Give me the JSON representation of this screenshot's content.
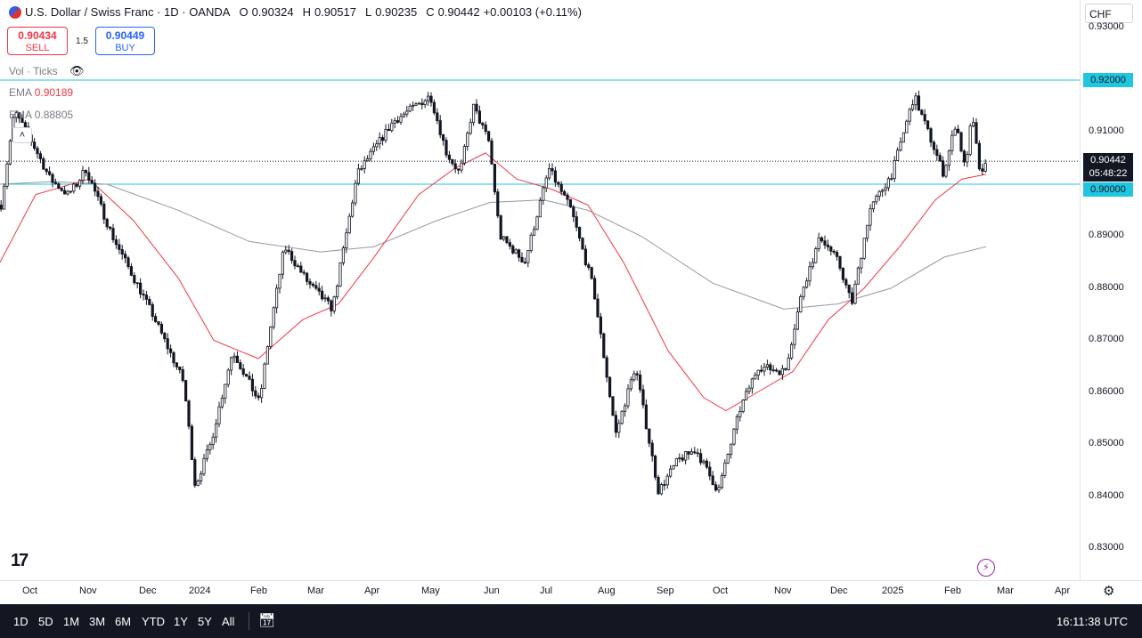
{
  "header": {
    "symbol": "U.S. Dollar / Swiss Franc · 1D · OANDA",
    "open_k": "O",
    "open": "0.90324",
    "high_k": "H",
    "high": "0.90517",
    "low_k": "L",
    "low": "0.90235",
    "close_k": "C",
    "close": "0.90442",
    "change": "+0.00103 (+0.11%)"
  },
  "trade": {
    "sell_price": "0.90434",
    "sell_label": "SELL",
    "spread": "1.5",
    "buy_price": "0.90449",
    "buy_label": "BUY"
  },
  "indicators": {
    "volume_label": "Vol · Ticks",
    "ema_fast_label": "EMA",
    "ema_fast_value": "0.90189",
    "ema_slow_label": "EMA",
    "ema_slow_value": "0.88805",
    "collapse_icon": "chevron-up"
  },
  "price_scale": {
    "currency": "CHF",
    "ticks": [
      "0.93000",
      "0.92000",
      "0.91000",
      "0.90000",
      "0.89000",
      "0.88000",
      "0.87000",
      "0.86000",
      "0.85000",
      "0.84000",
      "0.83000"
    ],
    "label_upper": "0.92000",
    "label_lower": "0.90000",
    "current_price": "0.90442",
    "countdown": "05:48:22"
  },
  "time_axis": [
    "Oct",
    "Nov",
    "Dec",
    "2024",
    "Feb",
    "Mar",
    "Apr",
    "May",
    "Jun",
    "Jul",
    "Aug",
    "Sep",
    "Oct",
    "Nov",
    "Dec",
    "2025",
    "Feb",
    "Mar",
    "Apr"
  ],
  "bottom_bar": {
    "ranges": [
      "1D",
      "5D",
      "1M",
      "3M",
      "6M",
      "YTD",
      "1Y",
      "5Y",
      "All"
    ],
    "clock": "16:11:38 UTC"
  },
  "colors": {
    "candle": "#131722",
    "ema_fast": "#f23645",
    "ema_slow": "#9598a1",
    "hline": "#20c5e0",
    "bar_bg": "#131722"
  },
  "chart_data": {
    "type": "candlestick",
    "ylim": [
      0.825,
      0.935
    ],
    "horizontal_lines": [
      0.92,
      0.9
    ],
    "current_price": 0.90442,
    "price_anchors": [
      {
        "t": 0,
        "p": 0.896
      },
      {
        "t": 15,
        "p": 0.914
      },
      {
        "t": 35,
        "p": 0.908
      },
      {
        "t": 55,
        "p": 0.901
      },
      {
        "t": 75,
        "p": 0.898
      },
      {
        "t": 85,
        "p": 0.9
      },
      {
        "t": 95,
        "p": 0.903
      },
      {
        "t": 125,
        "p": 0.89
      },
      {
        "t": 170,
        "p": 0.875
      },
      {
        "t": 205,
        "p": 0.862
      },
      {
        "t": 218,
        "p": 0.842
      },
      {
        "t": 235,
        "p": 0.85
      },
      {
        "t": 260,
        "p": 0.868
      },
      {
        "t": 290,
        "p": 0.858
      },
      {
        "t": 300,
        "p": 0.87
      },
      {
        "t": 318,
        "p": 0.888
      },
      {
        "t": 345,
        "p": 0.881
      },
      {
        "t": 372,
        "p": 0.876
      },
      {
        "t": 400,
        "p": 0.902
      },
      {
        "t": 440,
        "p": 0.912
      },
      {
        "t": 482,
        "p": 0.917
      },
      {
        "t": 500,
        "p": 0.906
      },
      {
        "t": 515,
        "p": 0.902
      },
      {
        "t": 530,
        "p": 0.915
      },
      {
        "t": 548,
        "p": 0.908
      },
      {
        "t": 560,
        "p": 0.89
      },
      {
        "t": 588,
        "p": 0.885
      },
      {
        "t": 615,
        "p": 0.903
      },
      {
        "t": 640,
        "p": 0.895
      },
      {
        "t": 665,
        "p": 0.88
      },
      {
        "t": 690,
        "p": 0.852
      },
      {
        "t": 712,
        "p": 0.865
      },
      {
        "t": 738,
        "p": 0.841
      },
      {
        "t": 760,
        "p": 0.847
      },
      {
        "t": 780,
        "p": 0.849
      },
      {
        "t": 805,
        "p": 0.841
      },
      {
        "t": 830,
        "p": 0.857
      },
      {
        "t": 850,
        "p": 0.865
      },
      {
        "t": 880,
        "p": 0.864
      },
      {
        "t": 900,
        "p": 0.88
      },
      {
        "t": 920,
        "p": 0.89
      },
      {
        "t": 940,
        "p": 0.885
      },
      {
        "t": 955,
        "p": 0.877
      },
      {
        "t": 975,
        "p": 0.895
      },
      {
        "t": 1000,
        "p": 0.902
      },
      {
        "t": 1025,
        "p": 0.917
      },
      {
        "t": 1045,
        "p": 0.908
      },
      {
        "t": 1058,
        "p": 0.902
      },
      {
        "t": 1072,
        "p": 0.912
      },
      {
        "t": 1082,
        "p": 0.903
      },
      {
        "t": 1090,
        "p": 0.913
      },
      {
        "t": 1100,
        "p": 0.901
      },
      {
        "t": 1107,
        "p": 0.9044
      }
    ],
    "ema_fast": [
      {
        "t": 0,
        "p": 0.885
      },
      {
        "t": 40,
        "p": 0.898
      },
      {
        "t": 100,
        "p": 0.901
      },
      {
        "t": 150,
        "p": 0.893
      },
      {
        "t": 200,
        "p": 0.882
      },
      {
        "t": 240,
        "p": 0.87
      },
      {
        "t": 290,
        "p": 0.8665
      },
      {
        "t": 340,
        "p": 0.874
      },
      {
        "t": 380,
        "p": 0.877
      },
      {
        "t": 420,
        "p": 0.886
      },
      {
        "t": 470,
        "p": 0.898
      },
      {
        "t": 510,
        "p": 0.903
      },
      {
        "t": 545,
        "p": 0.906
      },
      {
        "t": 580,
        "p": 0.901
      },
      {
        "t": 620,
        "p": 0.899
      },
      {
        "t": 660,
        "p": 0.896
      },
      {
        "t": 700,
        "p": 0.885
      },
      {
        "t": 750,
        "p": 0.868
      },
      {
        "t": 790,
        "p": 0.859
      },
      {
        "t": 815,
        "p": 0.8565
      },
      {
        "t": 850,
        "p": 0.86
      },
      {
        "t": 890,
        "p": 0.864
      },
      {
        "t": 930,
        "p": 0.874
      },
      {
        "t": 970,
        "p": 0.88
      },
      {
        "t": 1010,
        "p": 0.888
      },
      {
        "t": 1050,
        "p": 0.897
      },
      {
        "t": 1080,
        "p": 0.901
      },
      {
        "t": 1107,
        "p": 0.9019
      }
    ],
    "ema_slow": [
      {
        "t": 0,
        "p": 0.9
      },
      {
        "t": 60,
        "p": 0.9005
      },
      {
        "t": 120,
        "p": 0.9
      },
      {
        "t": 200,
        "p": 0.895
      },
      {
        "t": 280,
        "p": 0.889
      },
      {
        "t": 360,
        "p": 0.887
      },
      {
        "t": 420,
        "p": 0.888
      },
      {
        "t": 490,
        "p": 0.893
      },
      {
        "t": 550,
        "p": 0.8965
      },
      {
        "t": 610,
        "p": 0.897
      },
      {
        "t": 660,
        "p": 0.895
      },
      {
        "t": 720,
        "p": 0.89
      },
      {
        "t": 800,
        "p": 0.881
      },
      {
        "t": 880,
        "p": 0.876
      },
      {
        "t": 940,
        "p": 0.877
      },
      {
        "t": 1000,
        "p": 0.88
      },
      {
        "t": 1060,
        "p": 0.886
      },
      {
        "t": 1107,
        "p": 0.888
      }
    ]
  }
}
